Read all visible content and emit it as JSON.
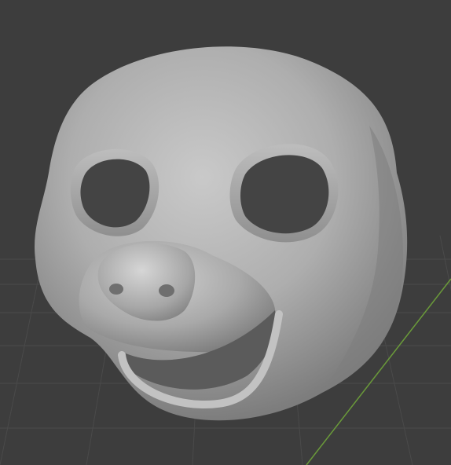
{
  "viewport": {
    "background_color": "#3d3d3d",
    "grid_color": "#4a4a4a",
    "x_axis_color": "#7a3a3a",
    "y_axis_color": "#6a9a3a",
    "object": {
      "name": "mask",
      "shading": "solid-matcap-gray",
      "base_color": "#a8a8a8"
    }
  }
}
